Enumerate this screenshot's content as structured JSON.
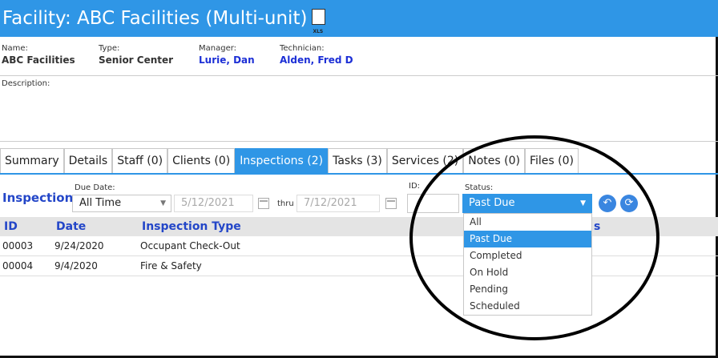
{
  "title": "Facility: ABC Facilities (Multi-unit)",
  "export_icon": "xls-file-icon",
  "info": {
    "name_label": "Name:",
    "name_value": "ABC Facilities",
    "type_label": "Type:",
    "type_value": "Senior Center",
    "manager_label": "Manager:",
    "manager_value": "Lurie, Dan",
    "technician_label": "Technician:",
    "technician_value": "Alden, Fred D",
    "description_label": "Description:"
  },
  "tabs": [
    {
      "label": "Summary",
      "active": false
    },
    {
      "label": "Details",
      "active": false
    },
    {
      "label": "Staff (0)",
      "active": false
    },
    {
      "label": "Clients (0)",
      "active": false
    },
    {
      "label": "Inspections (2)",
      "active": true
    },
    {
      "label": "Tasks (3)",
      "active": false
    },
    {
      "label": "Services (2)",
      "active": false
    },
    {
      "label": "Notes (0)",
      "active": false
    },
    {
      "label": "Files (0)",
      "active": false
    }
  ],
  "filters": {
    "section_title": "Inspections",
    "due_date_label": "Due Date:",
    "due_date_value": "All Time",
    "from_date": "5/12/2021",
    "thru_label": "thru",
    "to_date": "7/12/2021",
    "id_label": "ID:",
    "id_value": "",
    "status_label": "Status:",
    "status_value": "Past Due"
  },
  "table": {
    "columns": [
      "ID",
      "Date",
      "Inspection Type",
      "s"
    ],
    "rows": [
      {
        "id": "00003",
        "date": "9/24/2020",
        "type": "Occupant Check-Out"
      },
      {
        "id": "00004",
        "date": "9/4/2020",
        "type": "Fire & Safety"
      }
    ]
  },
  "status_options": [
    "All",
    "Past Due",
    "Completed",
    "On Hold",
    "Pending",
    "Scheduled"
  ],
  "selected_status_index": 1,
  "colors": {
    "accent": "#2f96e6",
    "link_blue": "#1c2fd6",
    "header_bg": "#e4e4e4"
  }
}
